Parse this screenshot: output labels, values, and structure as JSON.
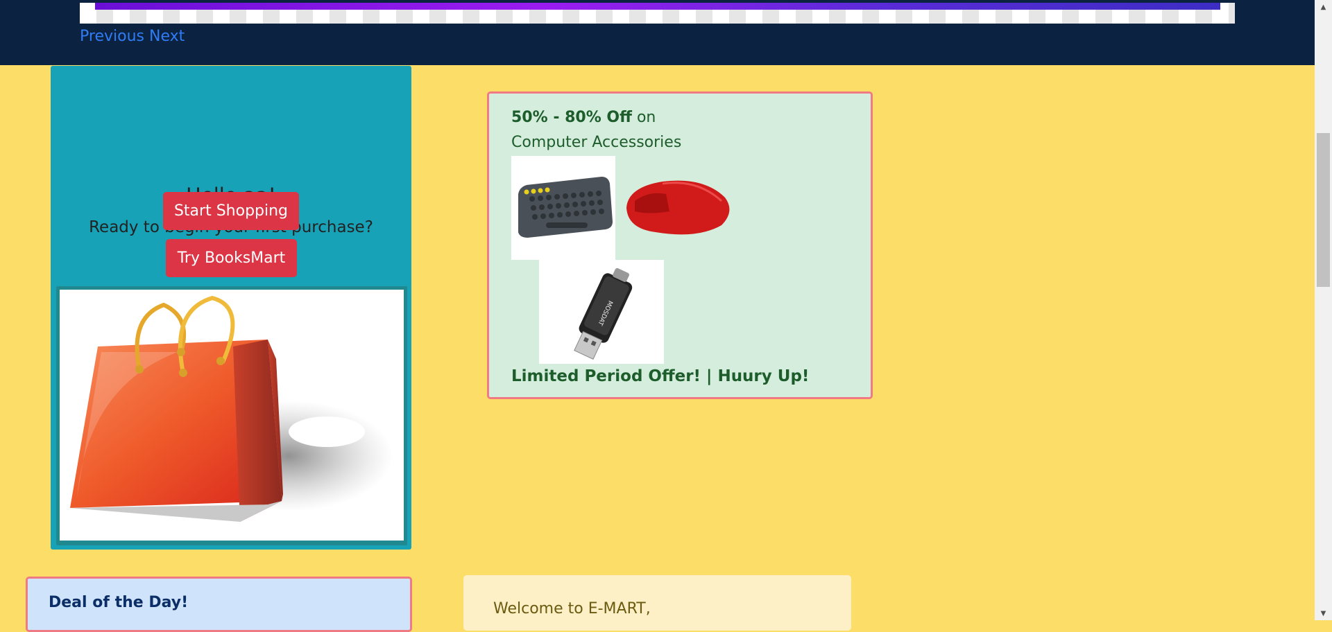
{
  "carousel": {
    "prev_label": "Previous",
    "next_label": "Next"
  },
  "welcome": {
    "title": "Hello aa!",
    "subtitle": "Ready to begin your first purchase?",
    "start_label": "Start Shopping",
    "books_label": "Try BooksMart"
  },
  "offer": {
    "discount": "50% - 80% Off",
    "on": " on",
    "category": "Computer Accessories",
    "footer": "Limited Period Offer! | Huury Up!"
  },
  "deal": {
    "title": "Deal of the Day!"
  },
  "greeting": {
    "text": "Welcome to E-MART,"
  },
  "colors": {
    "background": "#fcdd67",
    "navband": "#0b2340",
    "welcome_card": "#17a2b8",
    "button": "#dc3545",
    "offer_card": "#d4eddc",
    "offer_border": "#f07a84",
    "deal_card": "#cfe4fa",
    "link": "#2f7cf6"
  },
  "icons": {
    "scroll_up": "triangle-up-icon",
    "scroll_down": "triangle-down-icon"
  }
}
